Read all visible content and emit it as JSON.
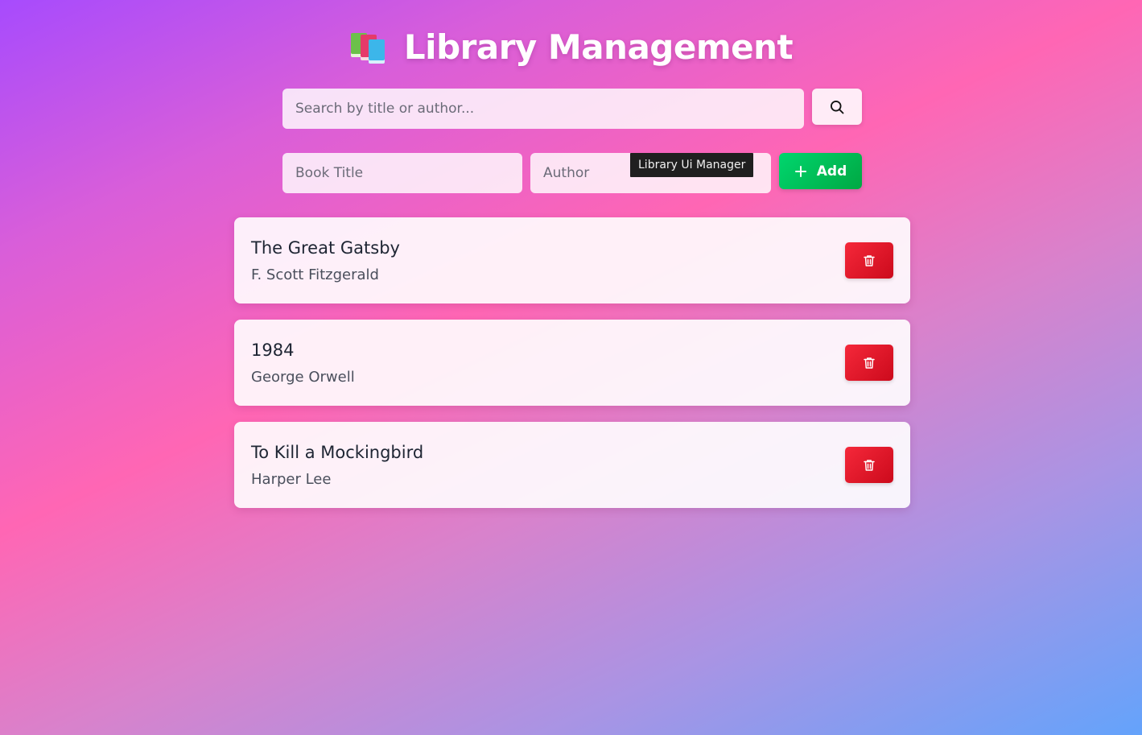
{
  "header": {
    "title": "Library Management",
    "icon": "books-icon"
  },
  "search": {
    "placeholder": "Search by title or author...",
    "value": "",
    "button_icon": "search-icon"
  },
  "add_form": {
    "title_placeholder": "Book Title",
    "author_placeholder": "Author",
    "add_label": "Add",
    "add_icon": "plus-icon",
    "tooltip": "Library Ui Manager"
  },
  "books": [
    {
      "title": "The Great Gatsby",
      "author": "F. Scott Fitzgerald"
    },
    {
      "title": "1984",
      "author": "George Orwell"
    },
    {
      "title": "To Kill a Mockingbird",
      "author": "Harper Lee"
    }
  ],
  "colors": {
    "add_button": "#00c05a",
    "delete_button": "#e8192c",
    "gradient_start": "#a74bfd",
    "gradient_mid": "#ff66b4",
    "gradient_end": "#64a3fb"
  }
}
